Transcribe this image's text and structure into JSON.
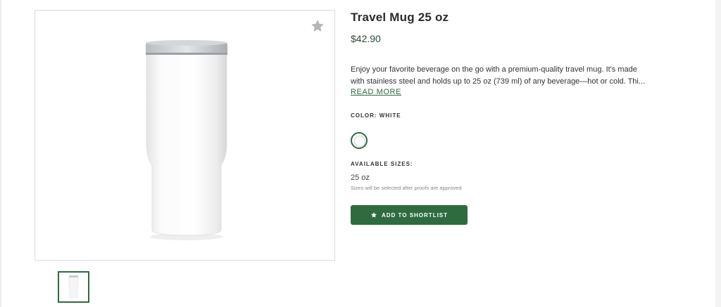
{
  "product": {
    "title": "Travel Mug 25 oz",
    "price": "$42.90",
    "description_lines": [
      "Enjoy your favorite beverage on the go with a premium-quality travel mug. It's made",
      "with stainless steel and holds up to 25 oz (739 ml) of any beverage—hot or cold. Thi..."
    ],
    "read_more": "READ MORE",
    "color_label": "COLOR: WHITE",
    "colors": [
      {
        "name": "White",
        "hex": "#ffffff",
        "selected": true
      }
    ],
    "sizes_label": "AVAILABLE SIZES:",
    "size_value": "25 oz",
    "size_note": "Sizes will be selected after proofs are approved",
    "shortlist_label": "ADD TO SHORTLIST"
  },
  "gallery": {
    "favorite_icon": "star-icon",
    "main_image": "white-travel-mug",
    "thumbnails": [
      {
        "image": "white-travel-mug",
        "selected": true
      }
    ]
  },
  "colors": {
    "accent": "#2e6b3f",
    "star_grey": "#b5b5b5",
    "border": "#dcdcdc"
  }
}
